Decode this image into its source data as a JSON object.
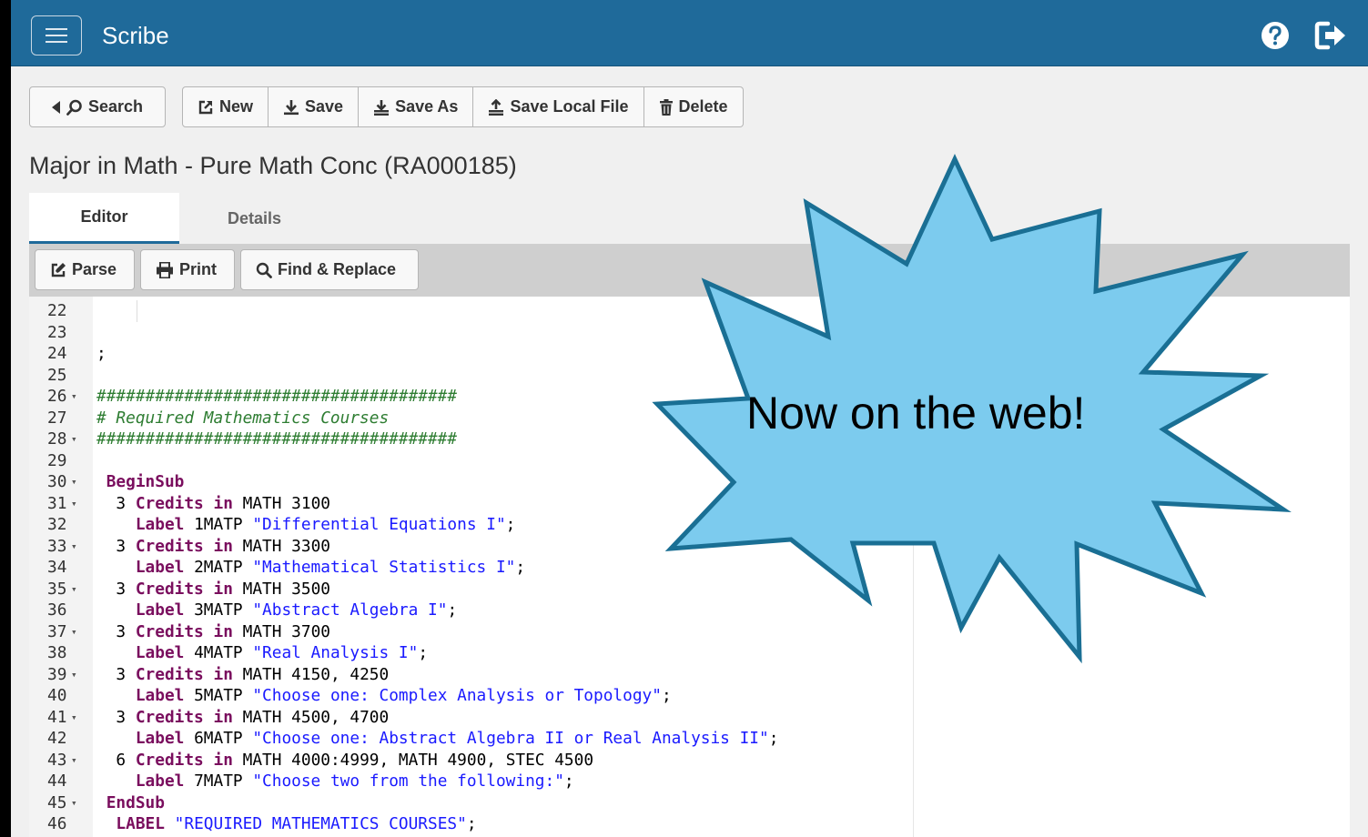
{
  "app": {
    "title": "Scribe"
  },
  "toolbar": {
    "search_label": "Search",
    "new_label": "New",
    "save_label": "Save",
    "save_as_label": "Save As",
    "save_local_label": "Save Local File",
    "delete_label": "Delete"
  },
  "document": {
    "title": "Major in Math - Pure Math Conc (RA000185)"
  },
  "tabs": [
    {
      "label": "Editor",
      "active": true
    },
    {
      "label": "Details",
      "active": false
    }
  ],
  "editor_toolbar": {
    "parse_label": "Parse",
    "print_label": "Print",
    "find_replace_label": "Find & Replace"
  },
  "code_lines": [
    {
      "num": "22",
      "text": ""
    },
    {
      "num": "23",
      "text": ""
    },
    {
      "num": "24",
      "text": ";"
    },
    {
      "num": "25",
      "text": ""
    },
    {
      "num": "26",
      "text": "#####################################",
      "fold": true
    },
    {
      "num": "27",
      "text": "# Required Mathematics Courses"
    },
    {
      "num": "28",
      "text": "#####################################",
      "fold": true
    },
    {
      "num": "29",
      "text": ""
    },
    {
      "num": "30",
      "text": " BeginSub",
      "fold": true
    },
    {
      "num": "31",
      "text": "  3 Credits in MATH 3100",
      "fold": true
    },
    {
      "num": "32",
      "text": "    Label 1MATP \"Differential Equations I\";"
    },
    {
      "num": "33",
      "text": "  3 Credits in MATH 3300",
      "fold": true
    },
    {
      "num": "34",
      "text": "    Label 2MATP \"Mathematical Statistics I\";"
    },
    {
      "num": "35",
      "text": "  3 Credits in MATH 3500",
      "fold": true
    },
    {
      "num": "36",
      "text": "    Label 3MATP \"Abstract Algebra I\";"
    },
    {
      "num": "37",
      "text": "  3 Credits in MATH 3700",
      "fold": true
    },
    {
      "num": "38",
      "text": "    Label 4MATP \"Real Analysis I\";"
    },
    {
      "num": "39",
      "text": "  3 Credits in MATH 4150, 4250",
      "fold": true
    },
    {
      "num": "40",
      "text": "    Label 5MATP \"Choose one: Complex Analysis or Topology\";"
    },
    {
      "num": "41",
      "text": "  3 Credits in MATH 4500, 4700",
      "fold": true
    },
    {
      "num": "42",
      "text": "    Label 6MATP \"Choose one: Abstract Algebra II or Real Analysis II\";"
    },
    {
      "num": "43",
      "text": "  6 Credits in MATH 4000:4999, MATH 4900, STEC 4500",
      "fold": true
    },
    {
      "num": "44",
      "text": "    Label 7MATP \"Choose two from the following:\";"
    },
    {
      "num": "45",
      "text": " EndSub",
      "fold": true
    },
    {
      "num": "46",
      "text": "  LABEL \"REQUIRED MATHEMATICS COURSES\";"
    }
  ],
  "callout": {
    "text": "Now on the web!"
  },
  "colors": {
    "header": "#1f6a9a",
    "burst_fill": "#7ccbee",
    "burst_stroke": "#1a6f94"
  }
}
